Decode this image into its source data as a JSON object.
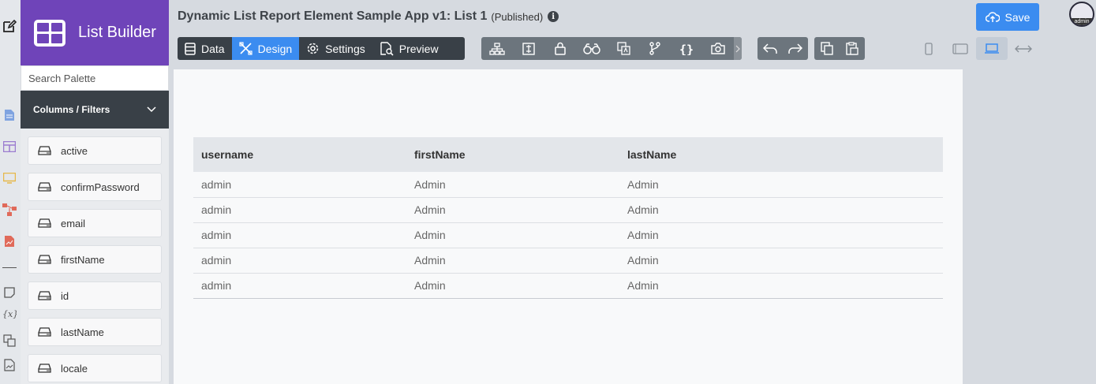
{
  "app": {
    "brand_title": "List Builder",
    "title": "Dynamic List Report Element Sample App v1: List 1",
    "status": "(Published)"
  },
  "header": {
    "save_label": "Save",
    "avatar_label": "admin"
  },
  "modes": [
    {
      "label": "Data",
      "icon": "database-icon"
    },
    {
      "label": "Design",
      "icon": "design-tools-icon",
      "active": true
    },
    {
      "label": "Settings",
      "icon": "gear-icon"
    },
    {
      "label": "Preview",
      "icon": "preview-icon"
    }
  ],
  "palette": {
    "search_placeholder": "Search Palette",
    "section_label": "Columns / Filters",
    "items": [
      "active",
      "confirmPassword",
      "email",
      "firstName",
      "id",
      "lastName",
      "locale"
    ]
  },
  "table": {
    "columns": [
      "username",
      "firstName",
      "lastName"
    ],
    "rows": [
      [
        "admin",
        "Admin",
        "Admin"
      ],
      [
        "admin",
        "Admin",
        "Admin"
      ],
      [
        "admin",
        "Admin",
        "Admin"
      ],
      [
        "admin",
        "Admin",
        "Admin"
      ],
      [
        "admin",
        "Admin",
        "Admin"
      ]
    ]
  },
  "colors": {
    "brand": "#6f44b9",
    "accent": "#3b8cf0",
    "dark": "#394047",
    "toolbar": "#6c757d"
  }
}
